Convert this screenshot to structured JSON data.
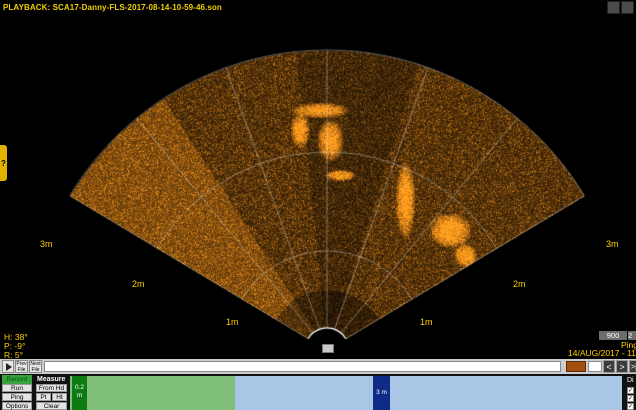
{
  "window": {
    "title": "PLAYBACK: SCA17-Danny-FLS-2017-08-14-10-59-46.son"
  },
  "help_tab": {
    "label": "?"
  },
  "range_labels": {
    "left_3m": "3m",
    "left_2m": "2m",
    "left_1m": "1m",
    "right_1m": "1m",
    "right_2m": "2m",
    "right_3m": "3m"
  },
  "orientation": {
    "heading": "H: 38°",
    "pitch": "P: -9°",
    "roll": "R: 5°"
  },
  "status": {
    "frequency": "900",
    "frequency_suffix": "2",
    "ping_label": "Ping",
    "date": "14/AUG/2017 - 11:"
  },
  "playback": {
    "prev_file_label": "Prev File",
    "next_file_label": "Next File",
    "nav_prev": "<",
    "nav_next": ">",
    "nav_end": ">|"
  },
  "controls": {
    "record_label": "Record",
    "run_label": "Run",
    "ping_label": "Ping",
    "options_label": "Options",
    "measure_label": "Measure",
    "from_hd_label": "From Hd",
    "pt_label": "Pt",
    "ht_label": "Ht",
    "clear_label": "Clear"
  },
  "depth_strip": {
    "marker_green": "0.2 m",
    "marker_blue": "3 m"
  },
  "right_panel": {
    "label": "Di",
    "checks": [
      "✓",
      "✓",
      "✓"
    ]
  },
  "colors": {
    "sonar": "#ff9a14",
    "label_yellow": "#ffd000",
    "record_green": "#36a33e",
    "strip_blue": "#a9c6e6",
    "strip_green": "#7fbf7a"
  }
}
